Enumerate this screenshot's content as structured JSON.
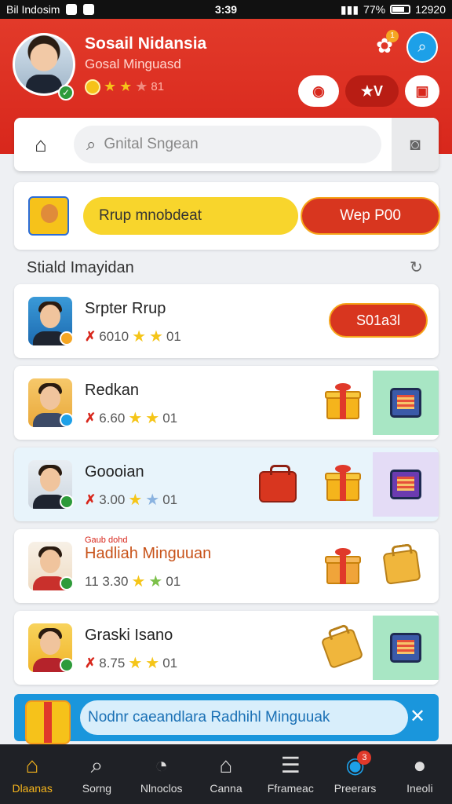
{
  "status_bar": {
    "carrier": "Bil Indosim",
    "time": "3:39",
    "battery": "77%",
    "extra": "12920"
  },
  "profile": {
    "name": "Sosail Nidansia",
    "subtitle": "Gosal Minguasd",
    "rating_text": "81"
  },
  "header_actions": {
    "puzzle_badge": "1",
    "mid_button": "★V"
  },
  "search": {
    "placeholder": "Gnital Sngean"
  },
  "promo": {
    "label": "Rrup mnobdeat",
    "button": "Wep P00"
  },
  "section": {
    "title": "Stiald Imayidan"
  },
  "list": [
    {
      "name": "Srpter Rrup",
      "meta": "6010",
      "count": "01",
      "button": "S01a3l"
    },
    {
      "name": "Redkan",
      "meta": "6.60",
      "count": "01"
    },
    {
      "name": "Goooian",
      "meta": "3.00",
      "count": "01"
    },
    {
      "name": "Hadliah Minguuan",
      "tag": "Gaub dohd",
      "meta": "11 3.30",
      "count": "01"
    },
    {
      "name": "Graski Isano",
      "meta": "8.75",
      "count": "01"
    }
  ],
  "toast": {
    "text": "Nodnr caeandlara Radhihl Minguuak"
  },
  "nav": [
    {
      "label": "Dlaanas",
      "icon": "home-icon"
    },
    {
      "label": "Sorng",
      "icon": "search-icon"
    },
    {
      "label": "Nlnoclos",
      "icon": "timer-icon"
    },
    {
      "label": "Canna",
      "icon": "house-icon"
    },
    {
      "label": "Fframeac",
      "icon": "list-icon"
    },
    {
      "label": "Preerars",
      "icon": "globe-icon",
      "badge": "3"
    },
    {
      "label": "Ineoli",
      "icon": "user-icon"
    }
  ],
  "colors": {
    "header_red": "#d8271c",
    "accent_yellow": "#f5b41c",
    "toast_blue": "#1a96dc",
    "nav_dark": "#1f2126"
  }
}
